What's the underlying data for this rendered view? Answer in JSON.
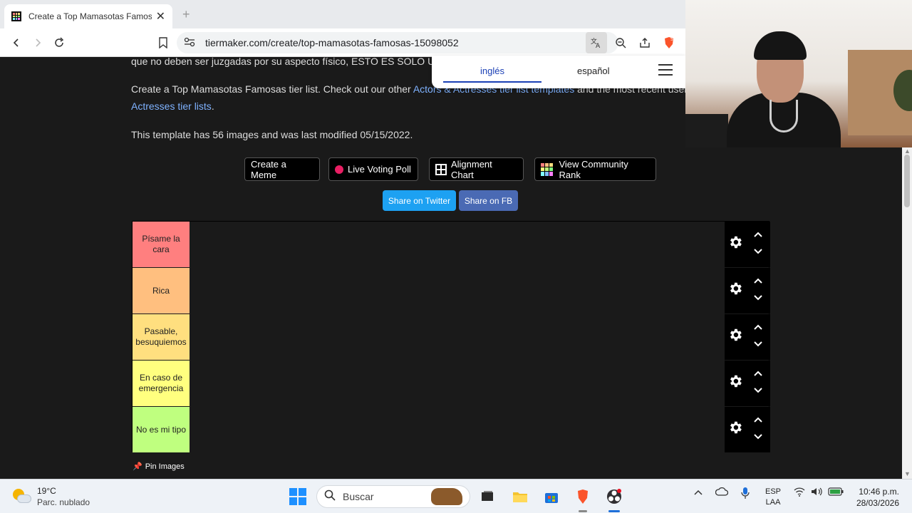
{
  "browser": {
    "tab_title": "Create a Top Mamasotas Famosas",
    "tab_close": "✕",
    "new_tab": "+",
    "url": "tiermaker.com/create/top-mamasotas-famosas-15098052",
    "shield_badge": "5"
  },
  "translate": {
    "selected_language": "inglés",
    "other_language": "español"
  },
  "page": {
    "partial_line": "que no deben ser juzgadas por su aspecto físico, ESTO ES SOLO UN",
    "intro_prefix": "Create a Top Mamasotas Famosas tier list. Check out our other ",
    "intro_link": "Actors & Actresses tier list templates",
    "intro_suffix": " and the most recent user su",
    "intro_link_line2": "Actresses tier lists",
    "intro_period": ".",
    "template_info": "This template has 56 images and was last modified 05/15/2022.",
    "buttons": {
      "create_meme": "Create a Meme",
      "live_voting": "Live Voting Poll",
      "alignment_chart": "Alignment Chart",
      "community_rank": "View Community Rank"
    },
    "share": {
      "twitter": "Share on Twitter",
      "facebook": "Share on FB",
      "twitter_color": "#1da1f2",
      "facebook_color": "#4a6ab4"
    },
    "tiers": [
      {
        "label": "Písame la cara",
        "color": "#ff7f7f"
      },
      {
        "label": "Rica",
        "color": "#ffbf7f"
      },
      {
        "label": "Pasable, besuquiemos",
        "color": "#ffdf7f"
      },
      {
        "label": "En caso de emergencia",
        "color": "#ffff7f"
      },
      {
        "label": "No es mi tipo",
        "color": "#bfff7f"
      }
    ],
    "pin_images": "Pin Images"
  },
  "taskbar": {
    "temperature": "19°C",
    "condition": "Parc. nublado",
    "search_placeholder": "Buscar",
    "lang_top": "ESP",
    "lang_bottom": "LAA",
    "time": "10:46 p.m.",
    "date": "28/03/2026"
  }
}
